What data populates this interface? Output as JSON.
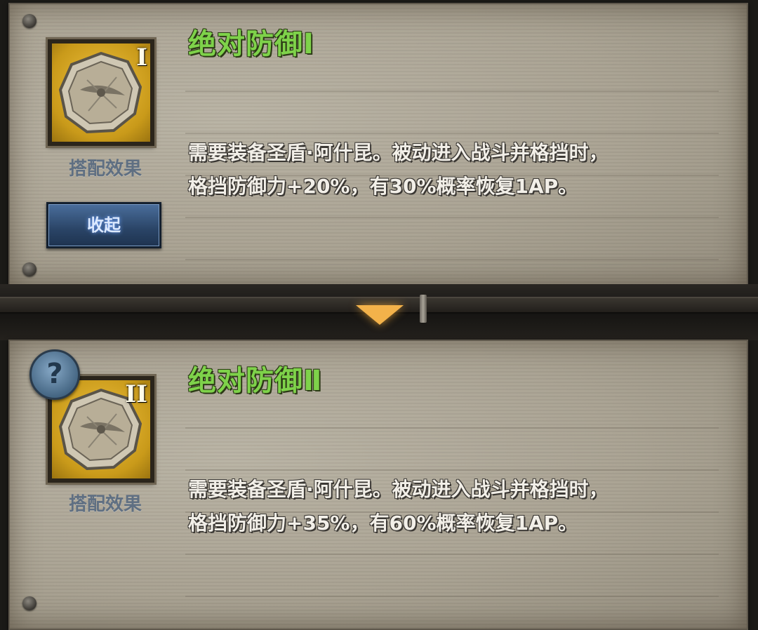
{
  "skills": [
    {
      "title": "绝对防御Ⅰ",
      "tier": "I",
      "combo_label": "搭配效果",
      "description_line1": "需要装备圣盾·阿什昆。被动进入战斗并格挡时，",
      "description_line2": "格挡防御力+20%，有30%概率恢复1AP。"
    },
    {
      "title": "绝对防御Ⅱ",
      "tier": "II",
      "combo_label": "搭配效果",
      "description_line1": "需要装备圣盾·阿什昆。被动进入战斗并格挡时，",
      "description_line2": "格挡防御力+35%，有60%概率恢复1AP。"
    }
  ],
  "collapse_button": {
    "label": "收起"
  },
  "help_icon": {
    "glyph": "?"
  },
  "icons": [
    "shield-emblem-icon",
    "help-icon",
    "expand-arrow-icon"
  ],
  "colors": {
    "title_green": "#7ed24a",
    "tier_gold": "#e3b02c",
    "button_blue": "#2a4466"
  }
}
